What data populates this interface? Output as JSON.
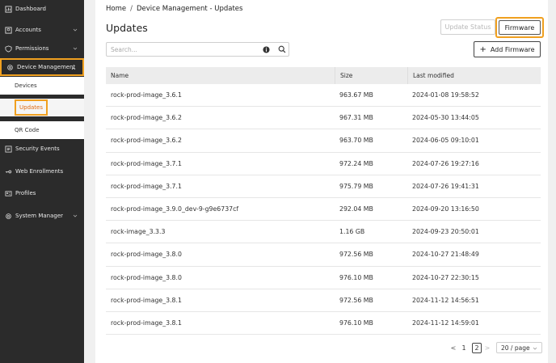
{
  "sidebar": {
    "items": [
      {
        "label": "Dashboard",
        "icon": "dashboard-icon"
      },
      {
        "label": "Accounts",
        "icon": "accounts-icon"
      },
      {
        "label": "Permissions",
        "icon": "shield-icon"
      },
      {
        "label": "Device Management",
        "icon": "gear-icon"
      },
      {
        "label": "Security Events",
        "icon": "log-icon"
      },
      {
        "label": "Web Enrollments",
        "icon": "key-icon"
      },
      {
        "label": "Profiles",
        "icon": "id-card-icon"
      },
      {
        "label": "System Manager",
        "icon": "gear-icon"
      }
    ],
    "sub_items": [
      {
        "label": "Devices"
      },
      {
        "label": "Updates"
      },
      {
        "label": "QR Code"
      }
    ]
  },
  "breadcrumb": {
    "home": "Home",
    "separator": "/",
    "current": "Device Management - Updates"
  },
  "page_title": "Updates",
  "toolbar": {
    "update_status_label": "Update Status",
    "firmware_label": "Firmware",
    "add_firmware_label": "Add Firmware"
  },
  "search": {
    "placeholder": "Search...",
    "value": ""
  },
  "table": {
    "headers": [
      "Name",
      "Size",
      "Last modified"
    ],
    "rows": [
      [
        "rock-prod-image_3.6.1",
        "963.67 MB",
        "2024-01-08 19:58:52"
      ],
      [
        "rock-prod-image_3.6.2",
        "967.31 MB",
        "2024-05-30 13:44:05"
      ],
      [
        "rock-prod-image_3.6.2",
        "963.70 MB",
        "2024-06-05 09:10:01"
      ],
      [
        "rock-prod-image_3.7.1",
        "972.24 MB",
        "2024-07-26 19:27:16"
      ],
      [
        "rock-prod-image_3.7.1",
        "975.79 MB",
        "2024-07-26 19:41:31"
      ],
      [
        "rock-prod-image_3.9.0_dev-9-g9e6737cf",
        "292.04 MB",
        "2024-09-20 13:16:50"
      ],
      [
        "rock-image_3.3.3",
        "1.16 GB",
        "2024-09-23 20:50:01"
      ],
      [
        "rock-prod-image_3.8.0",
        "972.56 MB",
        "2024-10-27 21:48:49"
      ],
      [
        "rock-prod-image_3.8.0",
        "976.10 MB",
        "2024-10-27 22:30:15"
      ],
      [
        "rock-prod-image_3.8.1",
        "972.56 MB",
        "2024-11-12 14:56:51"
      ],
      [
        "rock-prod-image_3.8.1",
        "976.10 MB",
        "2024-11-12 14:59:01"
      ]
    ]
  },
  "pagination": {
    "prev": "<",
    "pages": [
      "1",
      "2"
    ],
    "current": "2",
    "next": ">",
    "page_size": "20 / page"
  },
  "colors": {
    "accent": "#f0a020",
    "sidebar_bg": "#2b2b2b",
    "selected_text": "#e06a10"
  }
}
